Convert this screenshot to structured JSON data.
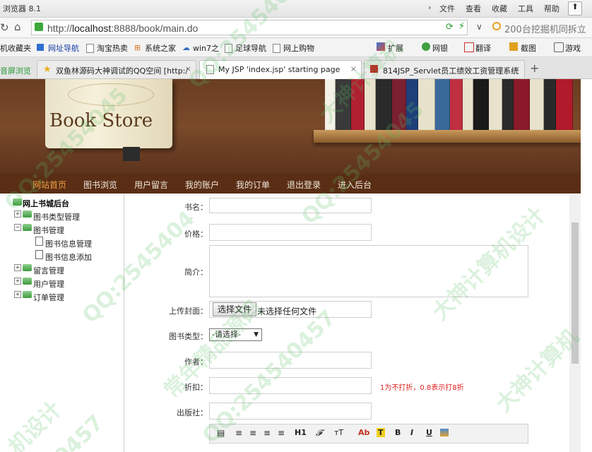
{
  "browser": {
    "app_title": "浏览器 8.1",
    "menu": [
      "文件",
      "查看",
      "收藏",
      "工具",
      "帮助"
    ],
    "url_scheme": "http://",
    "url_host": "localhost",
    "url_rest": ":8888/book/main.do",
    "search_hint": "200台挖掘机同拆立",
    "bookmarks": [
      "机收藏夹",
      "网址导航",
      "淘宝热卖",
      "系统之家",
      "win7之",
      "足球导航",
      "网上购物"
    ],
    "toolbar_right": [
      "扩展",
      "网银",
      "翻译",
      "截图",
      "游戏"
    ],
    "tabs": [
      {
        "label": "音屏浏览"
      },
      {
        "label": "双鱼林源码大神调试的QQ空间 [http:/"
      },
      {
        "label": "My JSP 'index.jsp' starting page"
      },
      {
        "label": "814JSP_Servlet员工绩效工资管理系统"
      }
    ]
  },
  "site": {
    "logo_text": "Book Store",
    "nav": [
      "网站首页",
      "图书浏览",
      "用户留言",
      "我的账户",
      "我的订单",
      "退出登录",
      "进入后台"
    ],
    "nav_active": 0
  },
  "sidebar": {
    "root": "网上书城后台",
    "items": [
      {
        "label": "图书类型管理"
      },
      {
        "label": "图书管理"
      },
      {
        "label": "图书信息管理"
      },
      {
        "label": "图书信息添加"
      },
      {
        "label": "留言管理"
      },
      {
        "label": "用户管理"
      },
      {
        "label": "订单管理"
      }
    ]
  },
  "form": {
    "name_label": "书名：",
    "price_label": "价格：",
    "intro_label": "简介：",
    "cover_label": "上传封面：",
    "file_button": "选择文件",
    "file_status": "未选择任何文件",
    "type_label": "图书类型：",
    "type_selected": "-请选择-",
    "author_label": "作者：",
    "discount_label": "折扣：",
    "discount_hint": "1为不打折，0.8表示打8折",
    "publisher_label": "出版社：",
    "editor_tools": [
      "H1",
      "Ab",
      "T",
      "B",
      "I",
      "U"
    ]
  },
  "watermarks": [
    "QQ:25454045",
    "大神计算机",
    "QQ:25454045",
    "常年精品源码",
    "QQ:2545404",
    "大神计算机",
    "机设计",
    "QQ:25454045",
    "QQ:254540457",
    "大神计算机设计",
    "0457"
  ],
  "colors": {
    "nav_bg": "#5a2e15",
    "nav_active": "#f0a040",
    "hint": "#e02020",
    "link": "#c88a10"
  }
}
